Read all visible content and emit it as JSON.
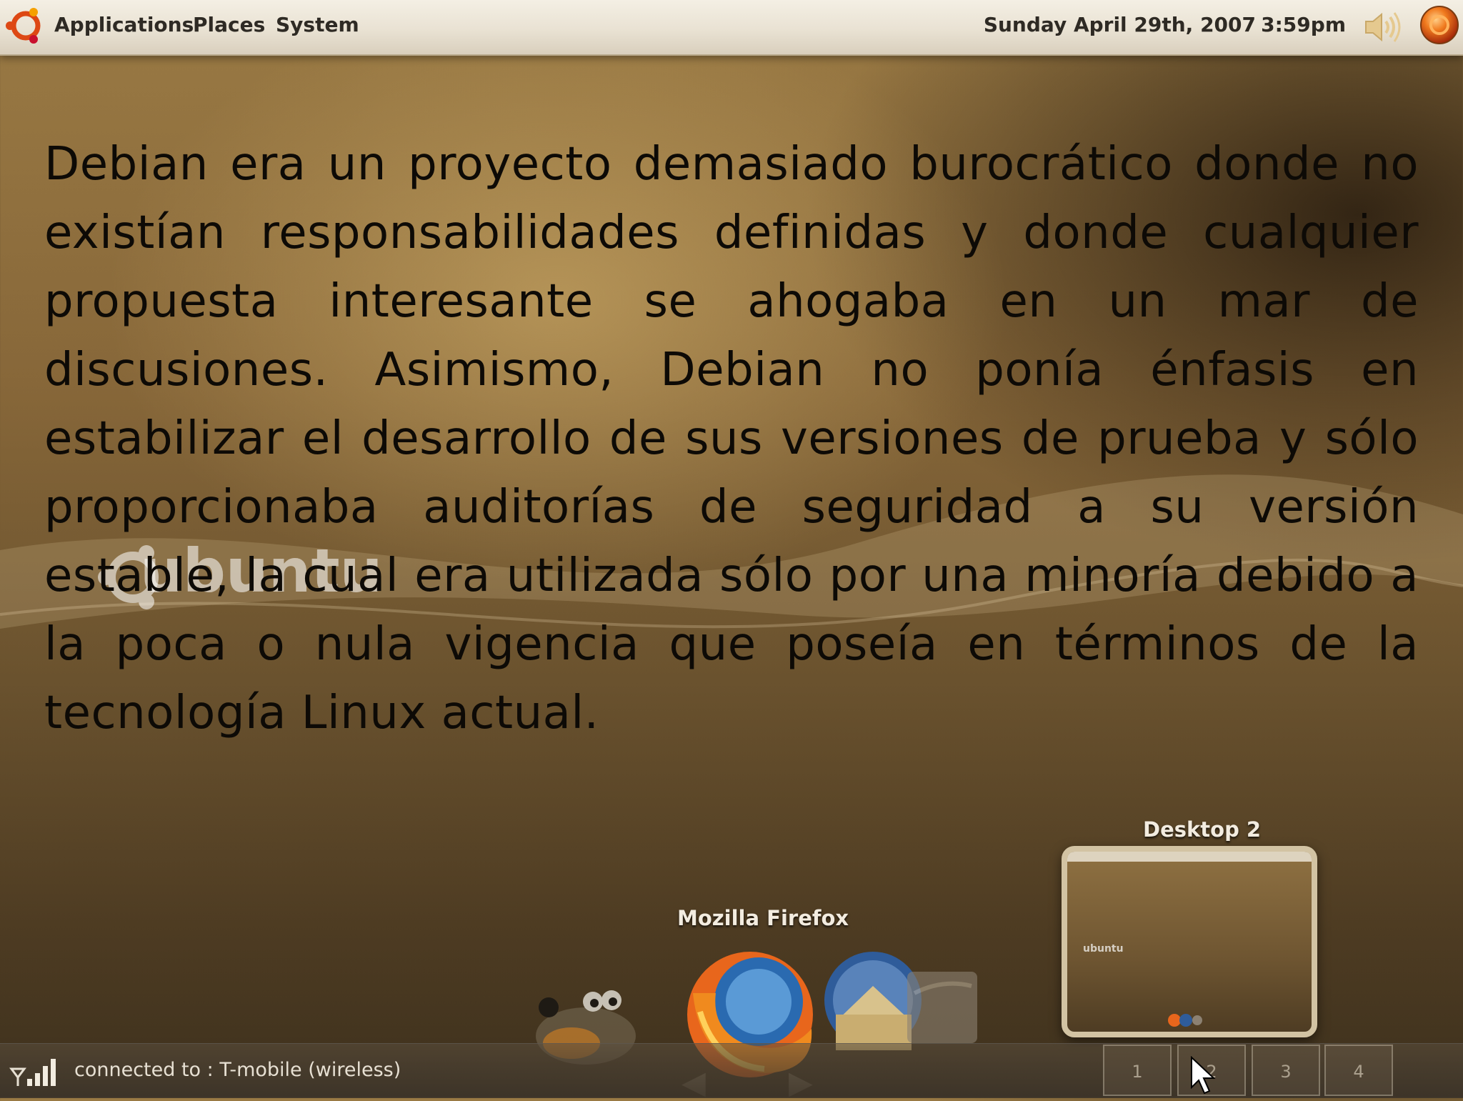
{
  "top_panel": {
    "menu": [
      "Applications",
      "Places",
      "System"
    ],
    "date": "Sunday April 29th, 2007",
    "time": "3:59pm"
  },
  "slide": {
    "paragraph": "Debian era un proyecto demasiado burocrático donde no existían responsabilidades definidas y donde cualquier propuesta interesante se ahogaba en un mar de discusiones. Asimismo, Debian no ponía énfasis en estabilizar el desarrollo de sus versiones de prueba y sólo proporcionaba auditorías de seguridad a su versión estable, la cual era utilizada sólo por una minoría debido a la poca o nula vigencia que poseía en términos de la tecnología Linux actual."
  },
  "watermark": {
    "text": "ubuntu"
  },
  "dock": {
    "active_label": "Mozilla Firefox",
    "icons": [
      "gimp-icon",
      "firefox-icon",
      "thunderbird-icon",
      "folder-icon"
    ]
  },
  "desktop_switcher": {
    "preview_label": "Desktop 2",
    "workspaces": [
      "1",
      "2",
      "3",
      "4"
    ]
  },
  "bottom_panel": {
    "network_status": "connected to : T-mobile (wireless)"
  },
  "colors": {
    "panel": "#e9e2d3",
    "background": "#876739",
    "text": "#0d0a06",
    "ubuntu_orange": "#dd4814"
  }
}
